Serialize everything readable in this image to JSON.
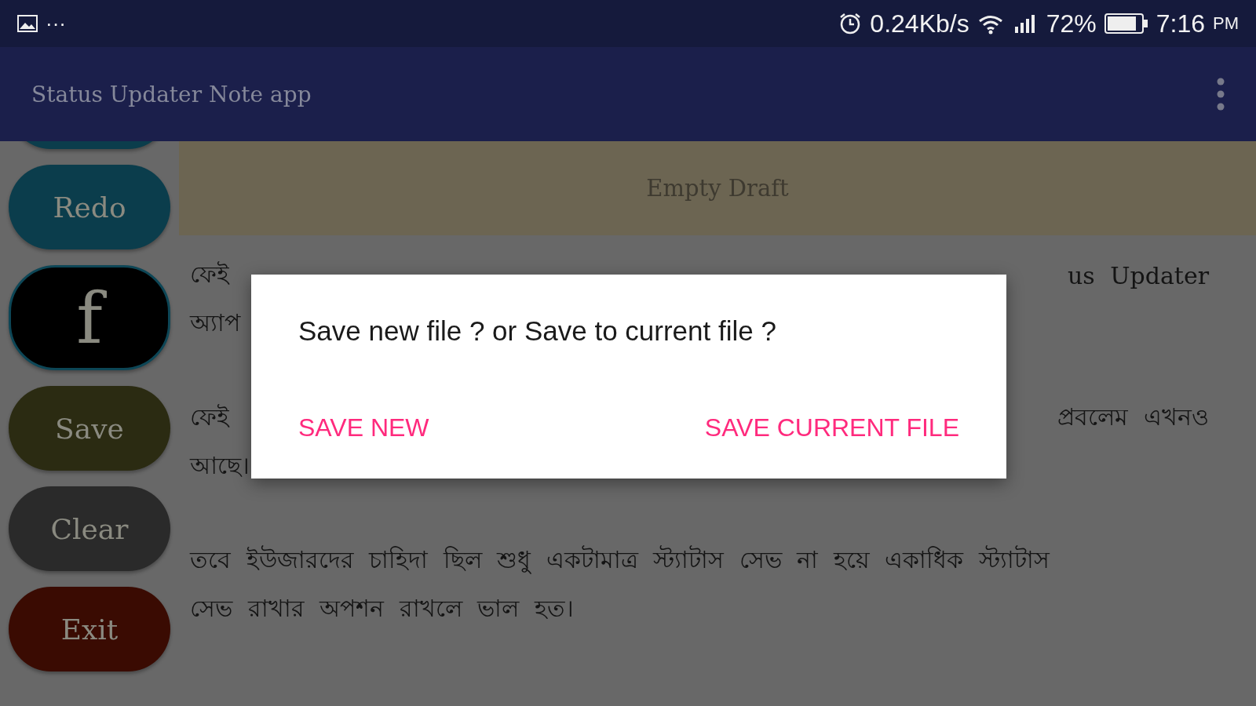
{
  "status_bar": {
    "more": "···",
    "speed": "0.24Kb/s",
    "battery": "72%",
    "time": "7:16",
    "ampm": "PM"
  },
  "app_bar": {
    "title": "Status Updater Note app"
  },
  "sidebar": {
    "buttons": [
      {
        "kind": "partial",
        "color": "#0b3d4c"
      },
      {
        "kind": "text",
        "label": "Redo",
        "color": "#0b3d4c"
      },
      {
        "kind": "facebook",
        "label": "f",
        "color": "#000000"
      },
      {
        "kind": "text",
        "label": "Save",
        "color": "#2b2b12"
      },
      {
        "kind": "text",
        "label": "Clear",
        "color": "#2a2a2a"
      },
      {
        "kind": "text",
        "label": "Exit",
        "color": "#3a0b02"
      }
    ]
  },
  "draft_bar": {
    "label": "Empty Draft"
  },
  "paragraphs": [
    {
      "lines": [
        {
          "left": "ফেই",
          "right": "us Updater"
        },
        {
          "left": "অ্যাপ"
        }
      ]
    },
    {
      "lines": [
        {
          "left": "ফেই",
          "right": "প্রবলেম এখনও"
        },
        {
          "left": "আছে।"
        }
      ]
    },
    {
      "lines": [
        {
          "left": "তবে ইউজারদের চাহিদা ছিল শুধু একটামাত্র স্ট্যাটাস সেভ না হয়ে একাধিক স্ট্যাটাস"
        },
        {
          "left": "সেভ রাখার অপশন রাখলে ভাল হত।"
        }
      ]
    }
  ],
  "dialog": {
    "message": "Save new file ? or Save to current file ?",
    "buttons": [
      "SAVE NEW",
      "SAVE CURRENT FILE"
    ]
  }
}
